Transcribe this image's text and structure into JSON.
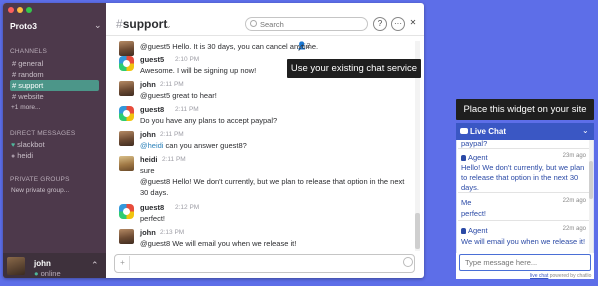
{
  "sidebar": {
    "team": "Proto3",
    "channels_title": "CHANNELS",
    "channels": [
      {
        "label": "# general"
      },
      {
        "label": "# random"
      },
      {
        "label": "# support"
      },
      {
        "label": "# website"
      }
    ],
    "more": "+1 more...",
    "dm_title": "DIRECT MESSAGES",
    "dms": [
      {
        "label": "slackbot"
      },
      {
        "label": "heidi"
      }
    ],
    "private_title": "PRIVATE GROUPS",
    "new_group": "New private group...",
    "user": {
      "name": "john",
      "status": "online"
    }
  },
  "header": {
    "hash": "#",
    "channel": "support",
    "search_placeholder": "Search",
    "members": "2"
  },
  "messages": [
    {
      "name": "",
      "time": "",
      "text": "@guest5 Hello.  It is 30 days, you can cancel anytime."
    },
    {
      "name": "guest5",
      "time": "2:10 PM",
      "text": "Awesome.  I will be signing up now!"
    },
    {
      "name": "john",
      "time": "2:11 PM",
      "text": "@guest5 great to hear!"
    },
    {
      "name": "guest8",
      "time": "2:11 PM",
      "text": "Do you have any plans to accept paypal?"
    },
    {
      "name": "john",
      "time": "2:11 PM",
      "mention": "@heidi",
      "text": " can you answer guest8?"
    },
    {
      "name": "heidi",
      "time": "2:11 PM",
      "text": "sure"
    },
    {
      "name": "",
      "time": "",
      "text": "@guest8 Hello! We don't currently, but we plan to release that option in the next 30 days."
    },
    {
      "name": "guest8",
      "time": "2:12 PM",
      "text": "perfect!"
    },
    {
      "name": "john",
      "time": "2:13 PM",
      "text": "@guest8 We will email you when we release it!"
    }
  ],
  "callouts": {
    "service": "Use your existing chat service",
    "widget": "Place this widget on your site"
  },
  "widget": {
    "title": "Live Chat",
    "partial": "paypal?",
    "messages": [
      {
        "name": "Agent",
        "time": "23m ago",
        "text": "Hello! We don't currently, but we plan to release that option in the next 30 days."
      },
      {
        "name": "Me",
        "time": "22m ago",
        "text": "perfect!"
      },
      {
        "name": "Agent",
        "time": "22m ago",
        "text": "We will email you when we release it!"
      }
    ],
    "input_placeholder": "Type message here...",
    "powered_link": "live chat",
    "powered_text": " powered by chatlio"
  },
  "colors": {
    "background": "#5d6ee8",
    "sidebar": "#4d394b",
    "active_channel": "#4c9689",
    "widget_header": "#3a57c4"
  }
}
